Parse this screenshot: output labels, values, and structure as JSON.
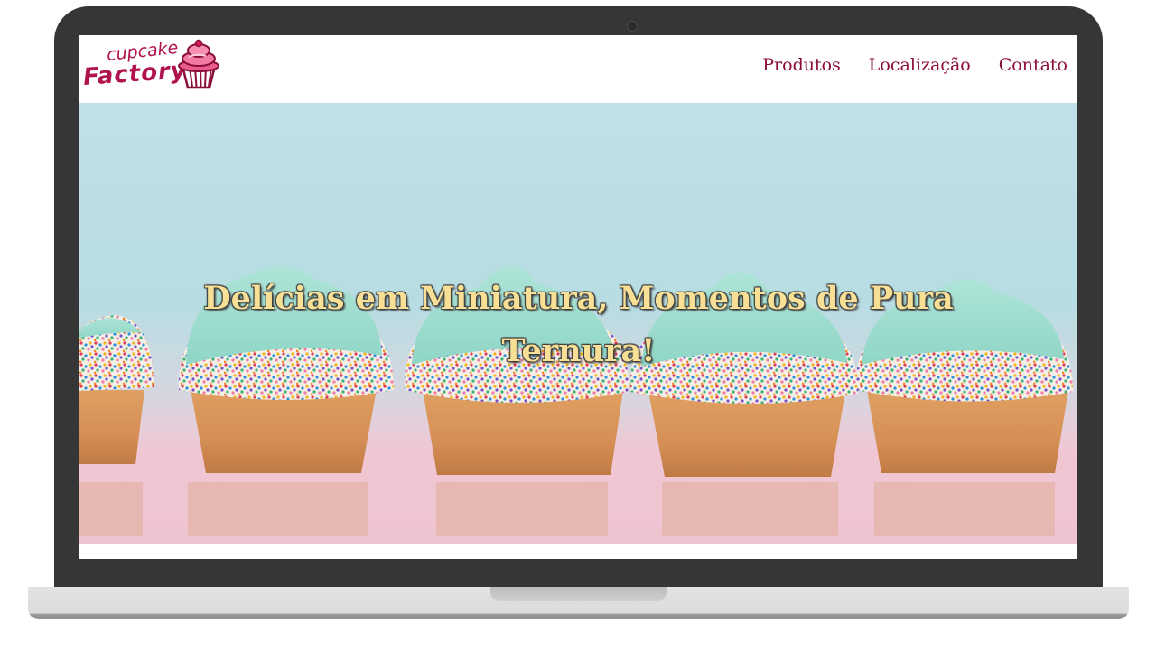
{
  "brand": {
    "logo_line1": "cupcake",
    "logo_line2": "Factory",
    "accent_color": "#b0124e"
  },
  "nav": {
    "items": [
      {
        "label": "Produtos"
      },
      {
        "label": "Localização"
      },
      {
        "label": "Contato"
      }
    ]
  },
  "hero": {
    "title": "Delícias em Miniatura, Momentos de Pura Ternura!",
    "image": "cupcakes-with-sprinkles-photo",
    "title_color": "#f7df96"
  },
  "icons": {
    "logo_icon": "cupcake-icon",
    "device": "laptop-mockup"
  }
}
